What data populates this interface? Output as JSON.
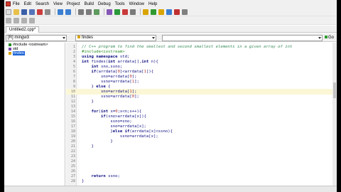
{
  "menu": [
    "File",
    "Edit",
    "Search",
    "View",
    "Project",
    "Build",
    "Debug",
    "Tools",
    "Window",
    "Help"
  ],
  "tab": {
    "label": "Untitled2.cpp*"
  },
  "combos": {
    "compiler": "[R] mingw3",
    "function": "findes",
    "scope": ""
  },
  "go_label": "Go",
  "tree": [
    {
      "label": "#include <iostream>",
      "selected": false
    },
    {
      "label": "std",
      "selected": false
    },
    {
      "label": "findes",
      "selected": true
    }
  ],
  "code": [
    {
      "n": "1",
      "t": "// C++ program to find the smallest and second smallest elements in a given array of int"
    },
    {
      "n": "2",
      "t": "#include<iostream>"
    },
    {
      "n": "3",
      "t": "using namespace std;"
    },
    {
      "n": "4",
      "t": "int findes(int arrdata[],int n){"
    },
    {
      "n": "5",
      "t": "    int sno,ssno;"
    },
    {
      "n": "6",
      "t": "    if(arrdata[0]<arrdata[1]){"
    },
    {
      "n": "7",
      "t": "        sno=arrdata[0];"
    },
    {
      "n": "8",
      "t": "        ssno=arrdata[1];"
    },
    {
      "n": "9",
      "t": "    } else {"
    },
    {
      "n": "10",
      "t": "        sno=arrdata[1];"
    },
    {
      "n": "11",
      "t": "        ssno=arrdata[0];"
    },
    {
      "n": "12",
      "t": "    }"
    },
    {
      "n": "13",
      "t": ""
    },
    {
      "n": "14",
      "t": "    for(int x=0;x<n;x++){"
    },
    {
      "n": "15",
      "t": "        if(sno>arrdata[x]){"
    },
    {
      "n": "16",
      "t": "            ssno=sno;"
    },
    {
      "n": "17",
      "t": "            sno=arrdata[x];"
    },
    {
      "n": "18",
      "t": "            }else if(arrdata[x]<ssno){"
    },
    {
      "n": "19",
      "t": "                ssno=arrdata[x];"
    },
    {
      "n": "20",
      "t": "            }"
    },
    {
      "n": "21",
      "t": "    }"
    },
    {
      "n": "22",
      "t": ""
    },
    {
      "n": "23",
      "t": ""
    },
    {
      "n": "24",
      "t": ""
    },
    {
      "n": "25",
      "t": ""
    },
    {
      "n": "26",
      "t": ""
    },
    {
      "n": "27",
      "t": "    return ssno;"
    },
    {
      "n": "28",
      "t": "}"
    }
  ],
  "current_line": "10"
}
